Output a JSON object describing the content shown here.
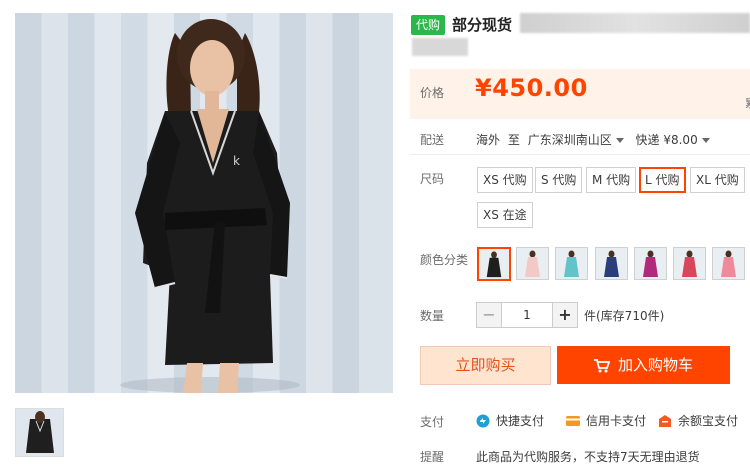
{
  "title": {
    "badge": "代购",
    "text": "部分现货"
  },
  "price": {
    "label": "价格",
    "value": "¥450.00",
    "edge_text": "累"
  },
  "shipping": {
    "label": "配送",
    "from": "海外",
    "to_word": "至",
    "destination": "广东深圳南山区",
    "method": "快递 ¥8.00"
  },
  "size": {
    "label": "尺码",
    "options": [
      "XS 代购",
      "S 代购",
      "M 代购",
      "L 代购",
      "XL 代购",
      "XS 在途"
    ],
    "selected": "L 代购"
  },
  "color": {
    "label": "颜色分类",
    "swatch_colors": [
      "#1f1f1f",
      "#f2c9c4",
      "#62c3c8",
      "#2a3f7a",
      "#b0297a",
      "#d8465b",
      "#f08a9a"
    ],
    "selected_index": 0
  },
  "quantity": {
    "label": "数量",
    "value": "1",
    "minus": "−",
    "plus": "+",
    "stock_text": "件(库存710件)"
  },
  "actions": {
    "buy_now": "立即购买",
    "add_to_cart": "加入购物车"
  },
  "payment": {
    "label": "支付",
    "methods": [
      {
        "label": "快捷支付",
        "icon": "quickpay-icon",
        "color": "#1e9fd8"
      },
      {
        "label": "信用卡支付",
        "icon": "credit-card-icon",
        "color": "#f39a1e"
      },
      {
        "label": "余额宝支付",
        "icon": "yuebao-icon",
        "color": "#f15a24"
      }
    ]
  },
  "notice": {
    "label": "提醒",
    "text": "此商品为代购服务，不支持7天无理由退货"
  },
  "colors": {
    "accent": "#ff4400",
    "price": "#ff4400",
    "badge_bg": "#2bb84a",
    "price_band_bg": "#fff2e8"
  }
}
